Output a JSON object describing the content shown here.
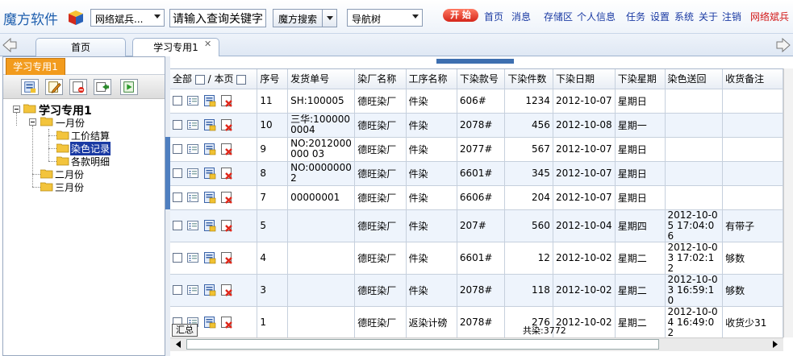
{
  "topbar": {
    "logo": "魔方软件",
    "site_combo": "网络斌兵...",
    "search_value": "请输入查询关键字",
    "search_button": "魔方搜索",
    "nav_combo": "导航树",
    "start": "开 始",
    "links": [
      "首页",
      "消息",
      "存储区",
      "个人信息",
      "任务",
      "设置",
      "系统",
      "关于",
      "注销"
    ],
    "user": "网络斌兵"
  },
  "tabs": [
    {
      "label": "首页"
    },
    {
      "label": "学习专用1"
    }
  ],
  "left_panel": {
    "tab_label": "学习专用1",
    "tree": {
      "root": "学习专用1",
      "month1": "一月份",
      "child1": "工价结算",
      "child2": "染色记录",
      "child3": "各款明细",
      "month2": "二月份",
      "month3": "三月份"
    }
  },
  "grid": {
    "header": {
      "all": "全部",
      "sep": "/",
      "page": "本页",
      "columns": [
        "序号",
        "发货单号",
        "染厂名称",
        "工序名称",
        "下染款号",
        "下染件数",
        "下染日期",
        "下染星期",
        "染色送回",
        "收货备注"
      ]
    },
    "rows": [
      {
        "no": "11",
        "ship": "SH:100005",
        "factory": "德旺染厂",
        "process": "件染",
        "style": "606#",
        "qty": "1234",
        "date": "2012-10-07",
        "weekday": "星期日",
        "returned": "",
        "note": ""
      },
      {
        "no": "10",
        "ship": "三华:1000000004",
        "factory": "德旺染厂",
        "process": "件染",
        "style": "2078#",
        "qty": "456",
        "date": "2012-10-08",
        "weekday": "星期一",
        "returned": "",
        "note": ""
      },
      {
        "no": "9",
        "ship": "NO:2012000000 03",
        "factory": "德旺染厂",
        "process": "件染",
        "style": "2077#",
        "qty": "567",
        "date": "2012-10-07",
        "weekday": "星期日",
        "returned": "",
        "note": ""
      },
      {
        "no": "8",
        "ship": "NO:00000002",
        "factory": "德旺染厂",
        "process": "件染",
        "style": "6601#",
        "qty": "345",
        "date": "2012-10-07",
        "weekday": "星期日",
        "returned": "",
        "note": ""
      },
      {
        "no": "7",
        "ship": "00000001",
        "factory": "德旺染厂",
        "process": "件染",
        "style": "6606#",
        "qty": "204",
        "date": "2012-10-07",
        "weekday": "星期日",
        "returned": "",
        "note": ""
      },
      {
        "no": "5",
        "ship": "",
        "factory": "德旺染厂",
        "process": "件染",
        "style": "207#",
        "qty": "560",
        "date": "2012-10-04",
        "weekday": "星期四",
        "returned": "2012-10-05 17:04:06",
        "note": "有带子"
      },
      {
        "no": "4",
        "ship": "",
        "factory": "德旺染厂",
        "process": "件染",
        "style": "6601#",
        "qty": "12",
        "date": "2012-10-02",
        "weekday": "星期二",
        "returned": "2012-10-03 17:02:12",
        "note": "够数"
      },
      {
        "no": "3",
        "ship": "",
        "factory": "德旺染厂",
        "process": "件染",
        "style": "2078#",
        "qty": "118",
        "date": "2012-10-02",
        "weekday": "星期二",
        "returned": "2012-10-03 16:59:10",
        "note": "够数"
      },
      {
        "no": "1",
        "ship": "",
        "factory": "德旺染厂",
        "process": "返染计磅",
        "style": "2078#",
        "qty": "276",
        "date": "2012-10-02",
        "weekday": "星期二",
        "returned": "2012-10-04 16:49:02",
        "note": "收货少31"
      }
    ],
    "summary_button": "汇总",
    "total": "共染:3772"
  },
  "colors": {
    "accent_orange": "#f29b1d",
    "link_blue": "#1a3aa3",
    "user_red": "#d21a1a",
    "row_alt": "#eef4fc"
  }
}
